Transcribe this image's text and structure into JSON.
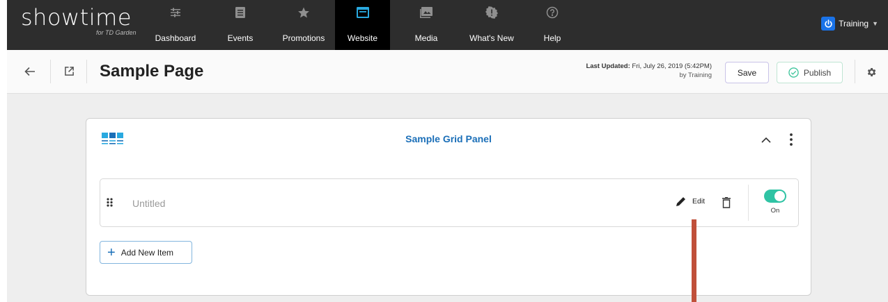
{
  "app": {
    "logo": "showtime",
    "logo_sub": "for TD Garden"
  },
  "nav": {
    "items": [
      {
        "label": "Dashboard",
        "icon": "sliders-icon"
      },
      {
        "label": "Events",
        "icon": "events-icon"
      },
      {
        "label": "Promotions",
        "icon": "star-icon"
      },
      {
        "label": "Website",
        "icon": "website-icon",
        "active": true
      },
      {
        "label": "Media",
        "icon": "media-icon"
      },
      {
        "label": "What's New",
        "icon": "whats-new-icon"
      },
      {
        "label": "Help",
        "icon": "help-icon"
      }
    ],
    "user": "Training",
    "user_icon": "power-icon"
  },
  "header": {
    "title": "Sample Page",
    "last_updated_label": "Last Updated:",
    "last_updated_value": "Fri, July 26, 2019 (5:42PM)",
    "updated_by": "by Training",
    "save_label": "Save",
    "publish_label": "Publish"
  },
  "panel": {
    "title": "Sample Grid Panel",
    "items": [
      {
        "name": "Untitled",
        "edit_label": "Edit",
        "toggle_label": "On",
        "enabled": true
      }
    ],
    "add_label": "Add New Item"
  },
  "colors": {
    "nav_bg": "#2d2d2d",
    "active_nav": "#000000",
    "panel_title": "#1b6fb8",
    "toggle_on": "#2fc3a4",
    "brand_blue": "#1a73e8",
    "annotation": "#c0503a"
  }
}
